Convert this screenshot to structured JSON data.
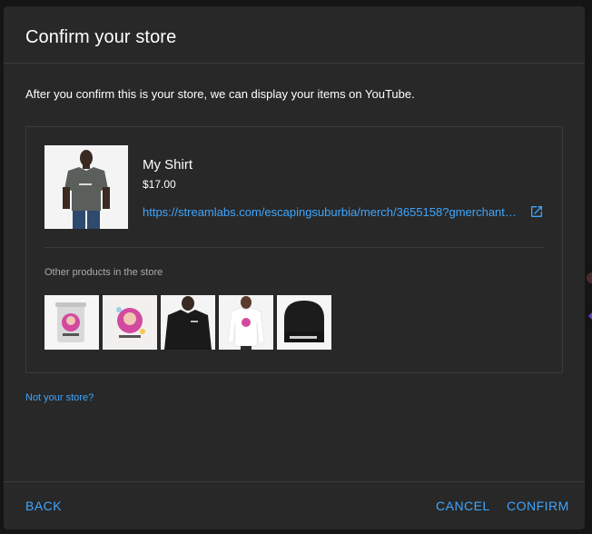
{
  "dialog": {
    "title": "Confirm your store",
    "description": "After you confirm this is your store, we can display your items on YouTube."
  },
  "product": {
    "name": "My Shirt",
    "price": "$17.00",
    "url": "https://streamlabs.com/escapingsuburbia/merch/3655158?gmerchant…",
    "image_icon": "shirt-photo"
  },
  "other_products": {
    "label": "Other products in the store",
    "items": [
      {
        "name": "tumbler",
        "icon": "tumbler-photo"
      },
      {
        "name": "print",
        "icon": "print-photo"
      },
      {
        "name": "dark-shirt",
        "icon": "dark-shirt-photo"
      },
      {
        "name": "long-sleeve",
        "icon": "long-sleeve-photo"
      },
      {
        "name": "beanie",
        "icon": "beanie-photo"
      }
    ]
  },
  "not_store_link": "Not your store?",
  "footer": {
    "back_label": "BACK",
    "cancel_label": "CANCEL",
    "confirm_label": "CONFIRM"
  },
  "colors": {
    "dialog_bg": "#282828",
    "backdrop": "#151515",
    "accent": "#3ea6ff",
    "divider": "#3c3c3c",
    "muted_text": "#aaaaaa"
  }
}
